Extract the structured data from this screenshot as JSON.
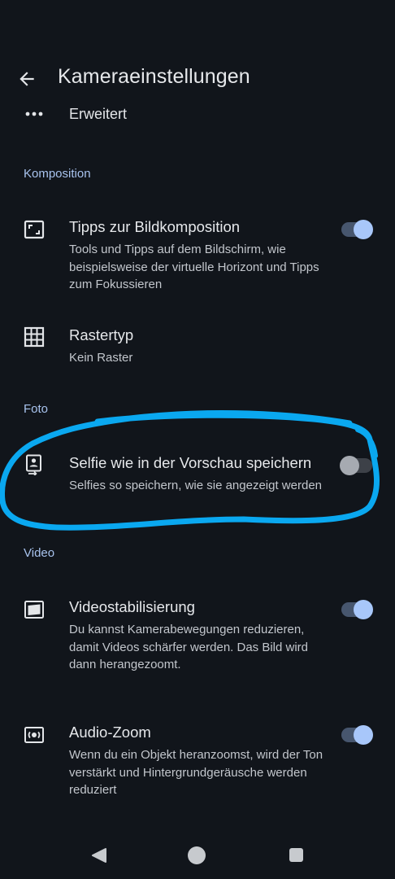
{
  "header": {
    "title": "Kameraeinstellungen"
  },
  "partial_item": {
    "label": "Erweitert",
    "icon": "more-dots-icon"
  },
  "sections": {
    "composition": "Komposition",
    "photo": "Foto",
    "video": "Video"
  },
  "settings": {
    "composition_tips": {
      "title": "Tipps zur Bildkomposition",
      "subtitle": "Tools und Tipps auf dem Bildschirm, wie beispielsweise der virtuelle Horizont und Tipps zum Fokussieren",
      "enabled": true,
      "icon": "frame-corners-icon"
    },
    "grid_type": {
      "title": "Rastertyp",
      "subtitle": "Kein Raster",
      "icon": "grid-icon"
    },
    "selfie_preview": {
      "title": "Selfie wie in der Vorschau speichern",
      "subtitle": "Selfies so speichern, wie sie angezeigt werden",
      "enabled": false,
      "icon": "selfie-portrait-icon"
    },
    "video_stabilization": {
      "title": "Videostabilisierung",
      "subtitle": "Du kannst Kamerabewegungen reduzieren, damit Videos schärfer werden. Das Bild wird dann herangezoomt.",
      "enabled": true,
      "icon": "stabilization-icon"
    },
    "audio_zoom": {
      "title": "Audio-Zoom",
      "subtitle": "Wenn du ein Objekt heranzoomst, wird der Ton verstärkt und Hintergrundgeräusche werden reduziert",
      "enabled": true,
      "icon": "audio-zoom-icon"
    }
  },
  "colors": {
    "background": "#11151b",
    "accent": "#a8c7fa",
    "section_header": "#a8c3ee",
    "annotation_highlight": "#0aa8f0"
  }
}
